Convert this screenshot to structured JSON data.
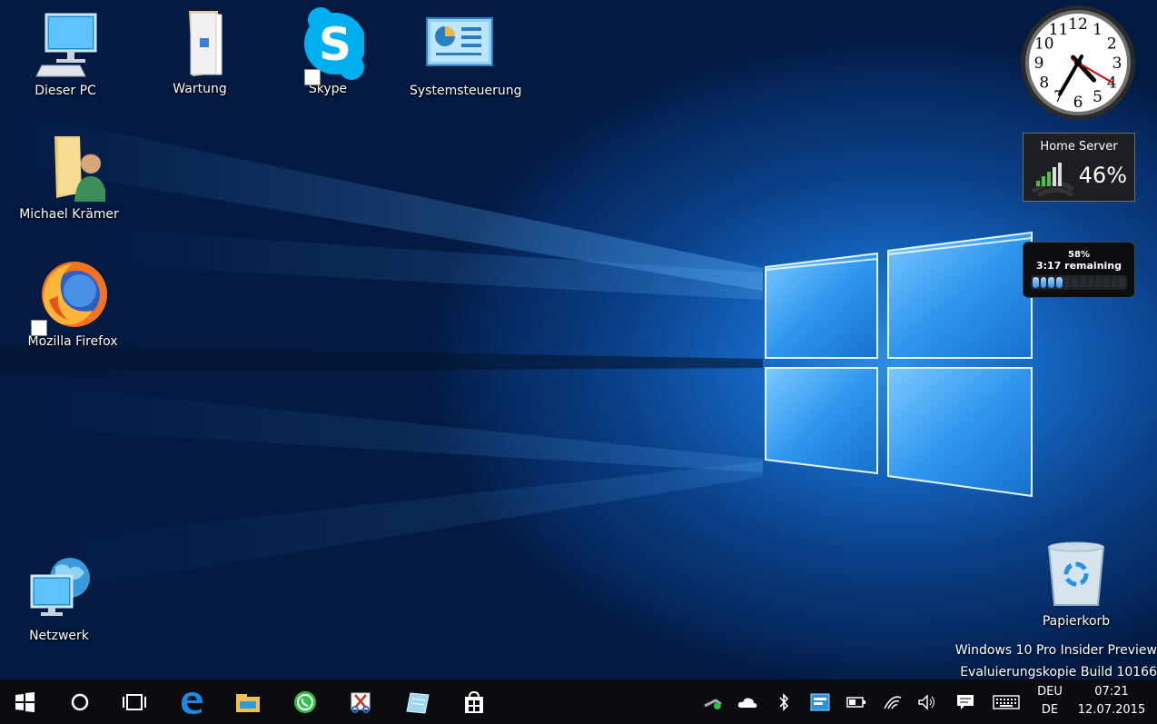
{
  "desktop_icons": {
    "dieser_pc": "Dieser PC",
    "wartung": "Wartung",
    "skype": "Skype",
    "systemsteuerung": "Systemsteuerung",
    "michael": "Michael Krämer",
    "firefox": "Mozilla Firefox",
    "netzwerk": "Netzwerk",
    "papierkorb": "Papierkorb"
  },
  "gadgets": {
    "clock": {
      "numbers": [
        "12",
        "1",
        "2",
        "3",
        "4",
        "5",
        "6",
        "7",
        "8",
        "9",
        "10",
        "11"
      ],
      "hour": 4,
      "minute": 35,
      "second": 20
    },
    "server": {
      "title": "Home Server",
      "percent": "46%",
      "signal_bars": 5
    },
    "battery": {
      "percent": "58%",
      "remaining": "3:17 remaining",
      "level": 0.58
    }
  },
  "watermark": {
    "line1": "Windows 10 Pro Insider Preview",
    "line2": "Evaluierungskopie Build 10166"
  },
  "taskbar": {
    "lang_top": "DEU",
    "lang_bottom": "DE",
    "time": "07:21",
    "date": "12.07.2015"
  },
  "colors": {
    "accent": "#0078d7",
    "taskbar_bg": "#0b0c0f",
    "desktop_light": "#2d8fe6"
  }
}
